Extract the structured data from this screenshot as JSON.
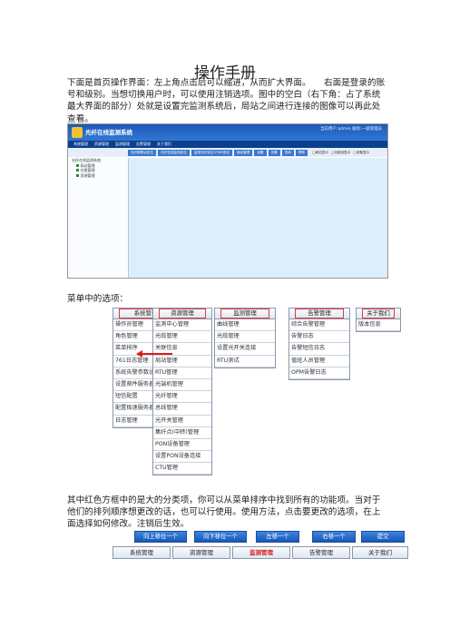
{
  "title": "操作手册",
  "intro": "下面是首页操作界面：左上角点击后可以缩进，从而扩大界面。　　右面是登录的账号和级别。当想切换用户时，可以使用注销选项。图中的空白（右下角：占了系统最大界面的部分）处就是设置完监测系统后，局站之间进行连接的图像可以再此处查看。",
  "screenshot": {
    "app_title": "光纤在线监测系统",
    "user_info": "当前用户:admin  级别:一级管理员",
    "menu": [
      "系统管理",
      "资源管理",
      "监测管理",
      "告警管理",
      "关于我们"
    ],
    "tabs": [
      "光纤故障点定位",
      "光纤在线监测定位",
      "监测光纤定位OTDR测试",
      "局站管理",
      "设置",
      "告警",
      "查询",
      "帮助"
    ],
    "checks": [
      "□局站显示",
      "□光缆段显示",
      "□设备显示"
    ],
    "tree": [
      "光纤在线监测系统",
      "局站管理",
      "光缆管理",
      "资源管理"
    ]
  },
  "menu_label": "菜单中的选项：",
  "menus": [
    {
      "head": "系统管理",
      "items": [
        "操作员管理",
        "角色管理",
        "菜单排序",
        "761日志管理",
        "系统告警参数设置",
        "设置邮件服务器",
        "短信配置",
        "配置极速服务器",
        "日志管理"
      ]
    },
    {
      "head": "资源管理",
      "items": [
        "监测中心管理",
        "光缆管理",
        "关联信息",
        "局站管理",
        "RTU管理",
        "光端机管理",
        "光纤管理",
        "总线管理",
        "光开关管理",
        "集纤点(中转)管理",
        "PON设备管理",
        "设置PON设备连接",
        "CTU管理"
      ]
    },
    {
      "head": "监测管理",
      "items": [
        "曲线管理",
        "光缆管理",
        "设置光开关连接",
        "RTU测试"
      ]
    },
    {
      "head": "告警管理",
      "items": [
        "综合告警管理",
        "告警日志",
        "告警短信日志",
        "值班人员管理",
        "OPM告警日志"
      ]
    },
    {
      "head": "关于我们",
      "items": [
        "版本信息"
      ]
    }
  ],
  "explain": "其中红色方框中的是大的分类项，你可以从菜单排序中找到所有的功能项。当对于他们的排列顺序想更改的话，也可以行使用。使用方法，点击要更改的选项，在上面选择如何修改。注销后生效。",
  "buttons": [
    "向上移位一个",
    "向下移位一个",
    "左移一个",
    "右移一个",
    "提交"
  ],
  "categories": [
    "系统管理",
    "资源管理",
    "监测管理",
    "告警管理",
    "关于我们"
  ],
  "colors": {
    "accent_blue": "#2f79d6",
    "highlight_red": "#e01a1a"
  }
}
